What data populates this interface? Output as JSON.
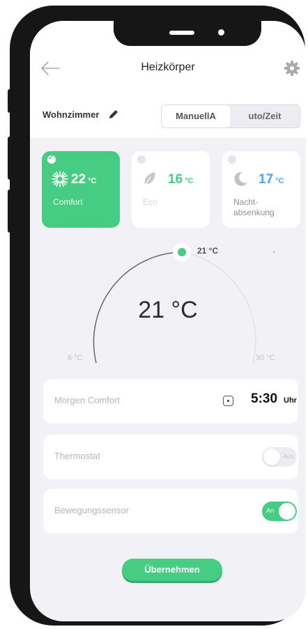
{
  "header": {
    "title": "Heizkörper",
    "back_icon": "arrow-left-icon",
    "settings_icon": "gear-icon"
  },
  "room": {
    "name": "Wohnzimmer",
    "edit_icon": "pencil-icon"
  },
  "mode_toggle": {
    "options": [
      "ManuellA",
      "uto/Zeit"
    ],
    "selected": "ManuellA"
  },
  "presets": [
    {
      "temp": "22",
      "unit": "°C",
      "label": "Comfort",
      "icon": "sun-icon",
      "selected": true,
      "color": "#ffffff"
    },
    {
      "temp": "16",
      "unit": "°C",
      "label": "Eco",
      "icon": "leaf-icon",
      "selected": false,
      "color": "#47cc84"
    },
    {
      "temp": "17",
      "unit": "°C",
      "label": "Nacht-\nabsenkung",
      "icon": "moon-icon",
      "selected": false,
      "color": "#4aa6e6"
    }
  ],
  "dial": {
    "current": "21 °C",
    "setpoint_label": "21 °C",
    "min_label": "6 °C",
    "max_label": "30 °C",
    "value": 21,
    "min": 6,
    "max": 30
  },
  "schedule": {
    "label": "Morgen Comfort",
    "time": "5:30",
    "unit": "Uhr",
    "icon": "clock-icon"
  },
  "thermostat": {
    "label": "Thermostat",
    "state": "Aus",
    "on": false
  },
  "motion_sensor": {
    "label": "Bewegungssensor",
    "state": "An",
    "on": true
  },
  "apply_button": "Übernehmen",
  "colors": {
    "accent": "#47cc84",
    "blue": "#4aa6e6",
    "background": "#f2f2f6"
  }
}
